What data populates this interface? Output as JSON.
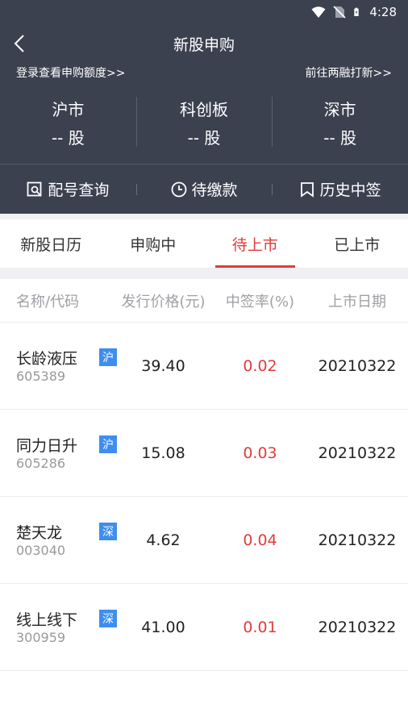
{
  "status": {
    "time": "4:28"
  },
  "header": {
    "title": "新股申购",
    "login_link": "登录查看申购额度>>",
    "margin_link": "前往两融打新>>"
  },
  "markets": [
    {
      "name": "沪市",
      "value": "-- 股"
    },
    {
      "name": "科创板",
      "value": "-- 股"
    },
    {
      "name": "深市",
      "value": "-- 股"
    }
  ],
  "actions": [
    {
      "label": "配号查询",
      "icon": "search-doc-icon"
    },
    {
      "label": "待缴款",
      "icon": "clock-icon"
    },
    {
      "label": "历史中签",
      "icon": "bookmark-icon"
    }
  ],
  "tabs": [
    {
      "label": "新股日历"
    },
    {
      "label": "申购中"
    },
    {
      "label": "待上市",
      "active": true
    },
    {
      "label": "已上市"
    }
  ],
  "table": {
    "headers": [
      "名称/代码",
      "发行价格(元)",
      "中签率(%)",
      "上市日期"
    ],
    "rows": [
      {
        "name": "长龄液压",
        "code": "605389",
        "badge": "沪",
        "price": "39.40",
        "rate": "0.02",
        "date": "20210322"
      },
      {
        "name": "同力日升",
        "code": "605286",
        "badge": "沪",
        "price": "15.08",
        "rate": "0.03",
        "date": "20210322"
      },
      {
        "name": "楚天龙",
        "code": "003040",
        "badge": "深",
        "price": "4.62",
        "rate": "0.04",
        "date": "20210322"
      },
      {
        "name": "线上线下",
        "code": "300959",
        "badge": "深",
        "price": "41.00",
        "rate": "0.01",
        "date": "20210322"
      }
    ]
  },
  "colors": {
    "header_bg": "#3c4150",
    "accent_red": "#e03c3c",
    "badge_blue": "#3d8ef0"
  }
}
